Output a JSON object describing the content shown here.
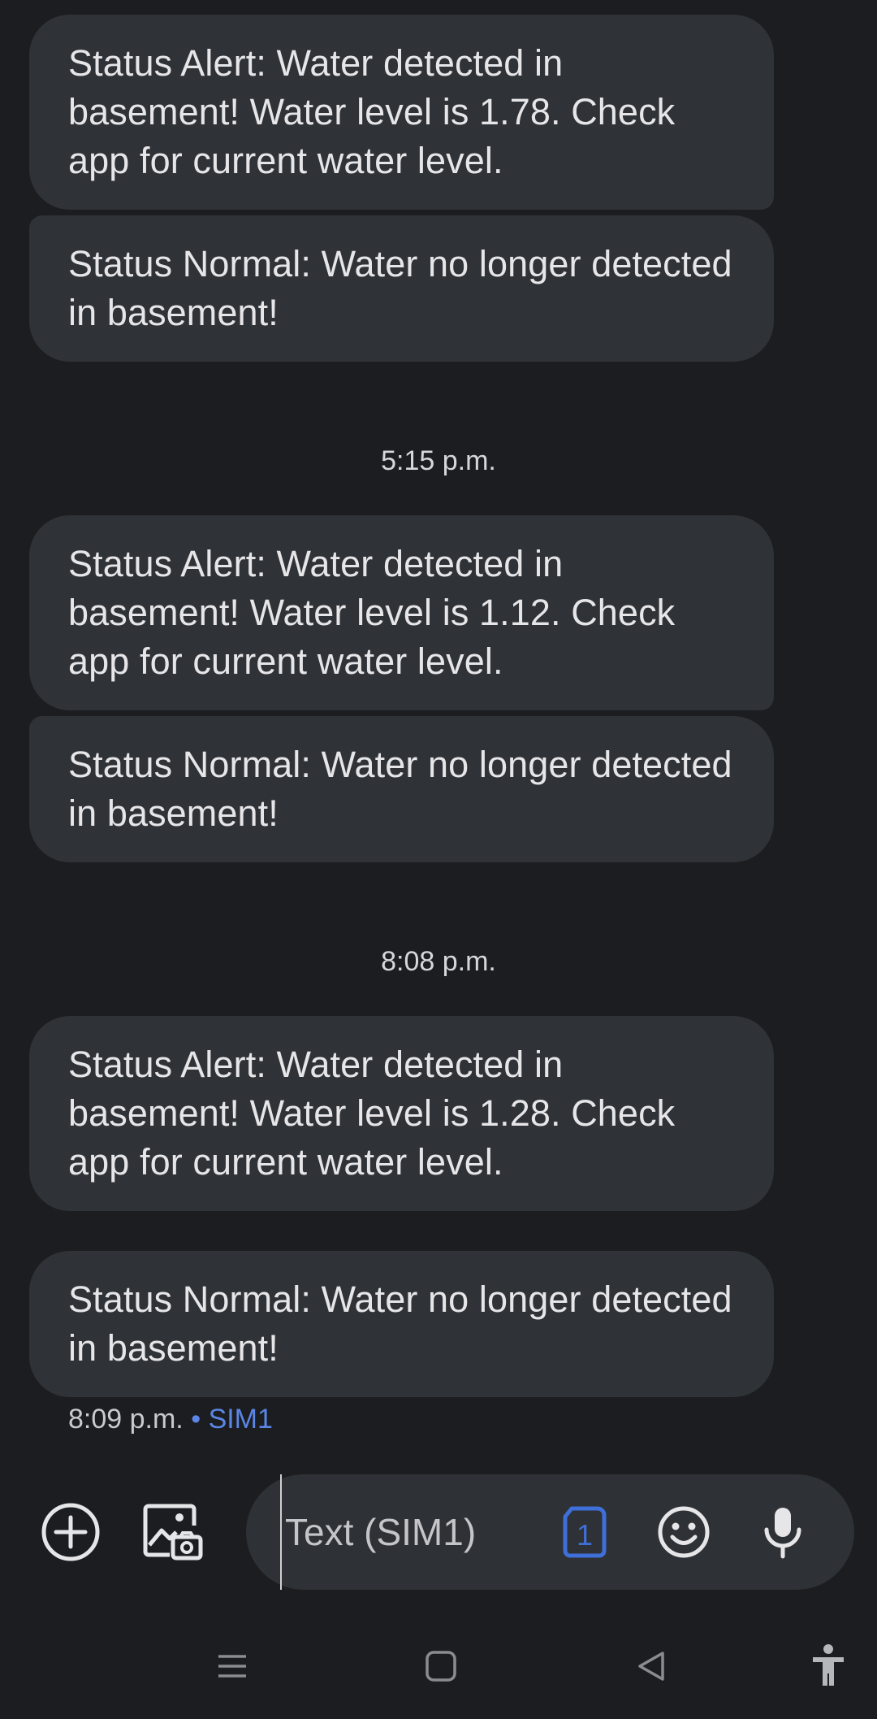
{
  "messages": [
    {
      "text": "Status Alert: Water detected in basement! Water level is 1.78. Check app for current water level."
    },
    {
      "text": "Status Normal: Water no longer detected in basement!"
    },
    {
      "text": "Status Alert: Water detected in basement! Water level is 1.12. Check app for current water level."
    },
    {
      "text": "Status Normal: Water no longer detected in basement!"
    },
    {
      "text": "Status Alert: Water detected in basement! Water level is 1.28. Check app for current water level."
    },
    {
      "text": "Status Normal: Water no longer detected in basement!"
    }
  ],
  "timestamps": [
    "5:15 p.m.",
    "8:08 p.m."
  ],
  "last_message_meta": {
    "time": "8:09 p.m.",
    "separator": "•",
    "sim": "SIM1"
  },
  "compose": {
    "placeholder": "Text (SIM1)",
    "sim_badge": "1"
  },
  "colors": {
    "background": "#1b1d20",
    "bubble": "#2f3236",
    "accent": "#3f6fd8"
  },
  "icons": {
    "add": "add-circle-icon",
    "gallery": "gallery-camera-icon",
    "sim": "sim-card-icon",
    "emoji": "emoji-icon",
    "mic": "microphone-icon",
    "recents": "recents-icon",
    "home": "home-icon",
    "back": "back-icon",
    "accessibility": "accessibility-icon"
  }
}
